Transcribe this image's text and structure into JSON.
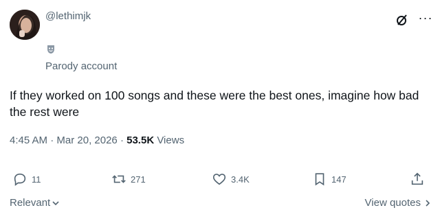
{
  "author": {
    "handle": "@lethimjk",
    "badge_icon": "theater-mask-icon",
    "label": "Parody account"
  },
  "tweet": {
    "text": "If they worked on 100 songs and these were the best ones, imagine how bad the rest were"
  },
  "meta": {
    "time": "4:45 AM",
    "separator1": "·",
    "date": "Mar 20, 2026",
    "separator2": "·",
    "views_count": "53.5K",
    "views_label": "Views"
  },
  "actions": {
    "replies": "11",
    "retweets": "271",
    "likes": "3.4K",
    "bookmarks": "147"
  },
  "footer": {
    "sort_label": "Relevant",
    "view_quotes_label": "View quotes"
  },
  "icons": {
    "grok": "grok-icon",
    "more": "more-icon",
    "reply": "reply-icon",
    "retweet": "retweet-icon",
    "like": "heart-icon",
    "bookmark": "bookmark-icon",
    "share": "share-icon"
  },
  "colors": {
    "text_primary": "#0f1419",
    "text_secondary": "#536471"
  }
}
